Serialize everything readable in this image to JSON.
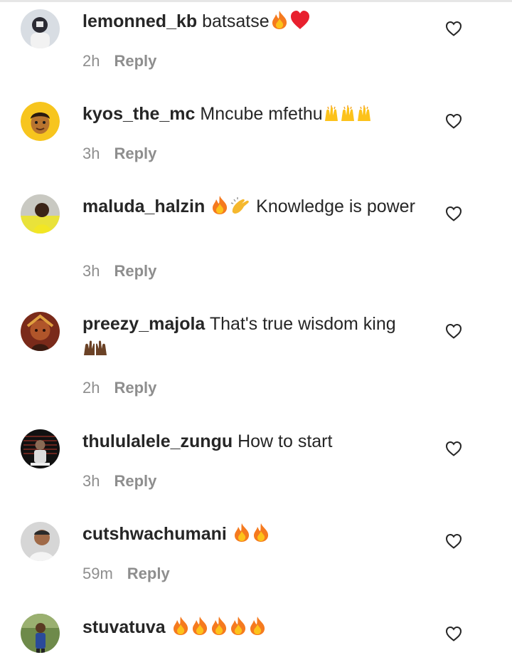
{
  "comments": [
    {
      "username": "lemonned_kb",
      "text": "batsatse",
      "time": "2h",
      "reply": "Reply",
      "emojis": [
        "fire-emoji",
        "red-heart-emoji"
      ]
    },
    {
      "username": "kyos_the_mc",
      "text": "Mncube mfethu",
      "time": "3h",
      "reply": "Reply",
      "emojis": [
        "raising-hands-emoji",
        "raising-hands-emoji",
        "raising-hands-emoji"
      ]
    },
    {
      "username": "maluda_halzin",
      "text": "Knowledge is power",
      "time": "3h",
      "reply": "Reply",
      "emojis": [
        "fire-emoji",
        "clapping-hands-emoji"
      ]
    },
    {
      "username": "preezy_majola",
      "text": "That's true wisdom king",
      "time": "2h",
      "reply": "Reply",
      "emojis": [
        "raising-hands-emoji"
      ]
    },
    {
      "username": "thululalele_zungu",
      "text": "How to start",
      "time": "3h",
      "reply": "Reply",
      "emojis": []
    },
    {
      "username": "cutshwachumani",
      "text": "",
      "time": "59m",
      "reply": "Reply",
      "emojis": [
        "fire-emoji",
        "fire-emoji"
      ]
    },
    {
      "username": "stuvatuva",
      "text": "",
      "time": "",
      "reply": "",
      "emojis": [
        "fire-emoji",
        "fire-emoji",
        "fire-emoji",
        "fire-emoji",
        "fire-emoji"
      ]
    }
  ],
  "icons": {
    "like": "heart-outline-icon"
  },
  "colors": {
    "text": "#262626",
    "secondary": "#8e8e8e",
    "background": "#ffffff"
  }
}
